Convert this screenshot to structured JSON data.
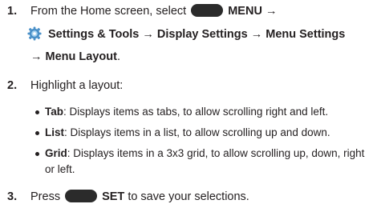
{
  "steps": [
    {
      "number": "1.",
      "line1_prefix": "From the Home screen, select",
      "menu_key_label": "MENU →",
      "line2": "Settings & Tools → Display Settings → Menu Settings",
      "line3_bold": "→ Menu Layout",
      "line3_end": "."
    },
    {
      "number": "2.",
      "text": "Highlight a layout:"
    },
    {
      "number": "3.",
      "prefix": "Press",
      "set_label": "SET",
      "suffix": "to save your selections."
    }
  ],
  "layouts": [
    {
      "term": "Tab",
      "desc": ": Displays items as tabs, to allow scrolling right and left."
    },
    {
      "term": "List",
      "desc": ": Displays items in a list, to allow scrolling up and down."
    },
    {
      "term": "Grid",
      "desc": ": Displays items in a 3x3 grid, to allow scrolling up, down, right",
      "desc2": "or left."
    }
  ],
  "colors": {
    "text": "#231f20",
    "key": "#2b2b2b",
    "gear_outer": "#4a90c8",
    "gear_inner": "#a9d4f0"
  },
  "icons": {
    "soft_key": "oval-soft-key-icon",
    "settings": "settings-gear-icon"
  }
}
